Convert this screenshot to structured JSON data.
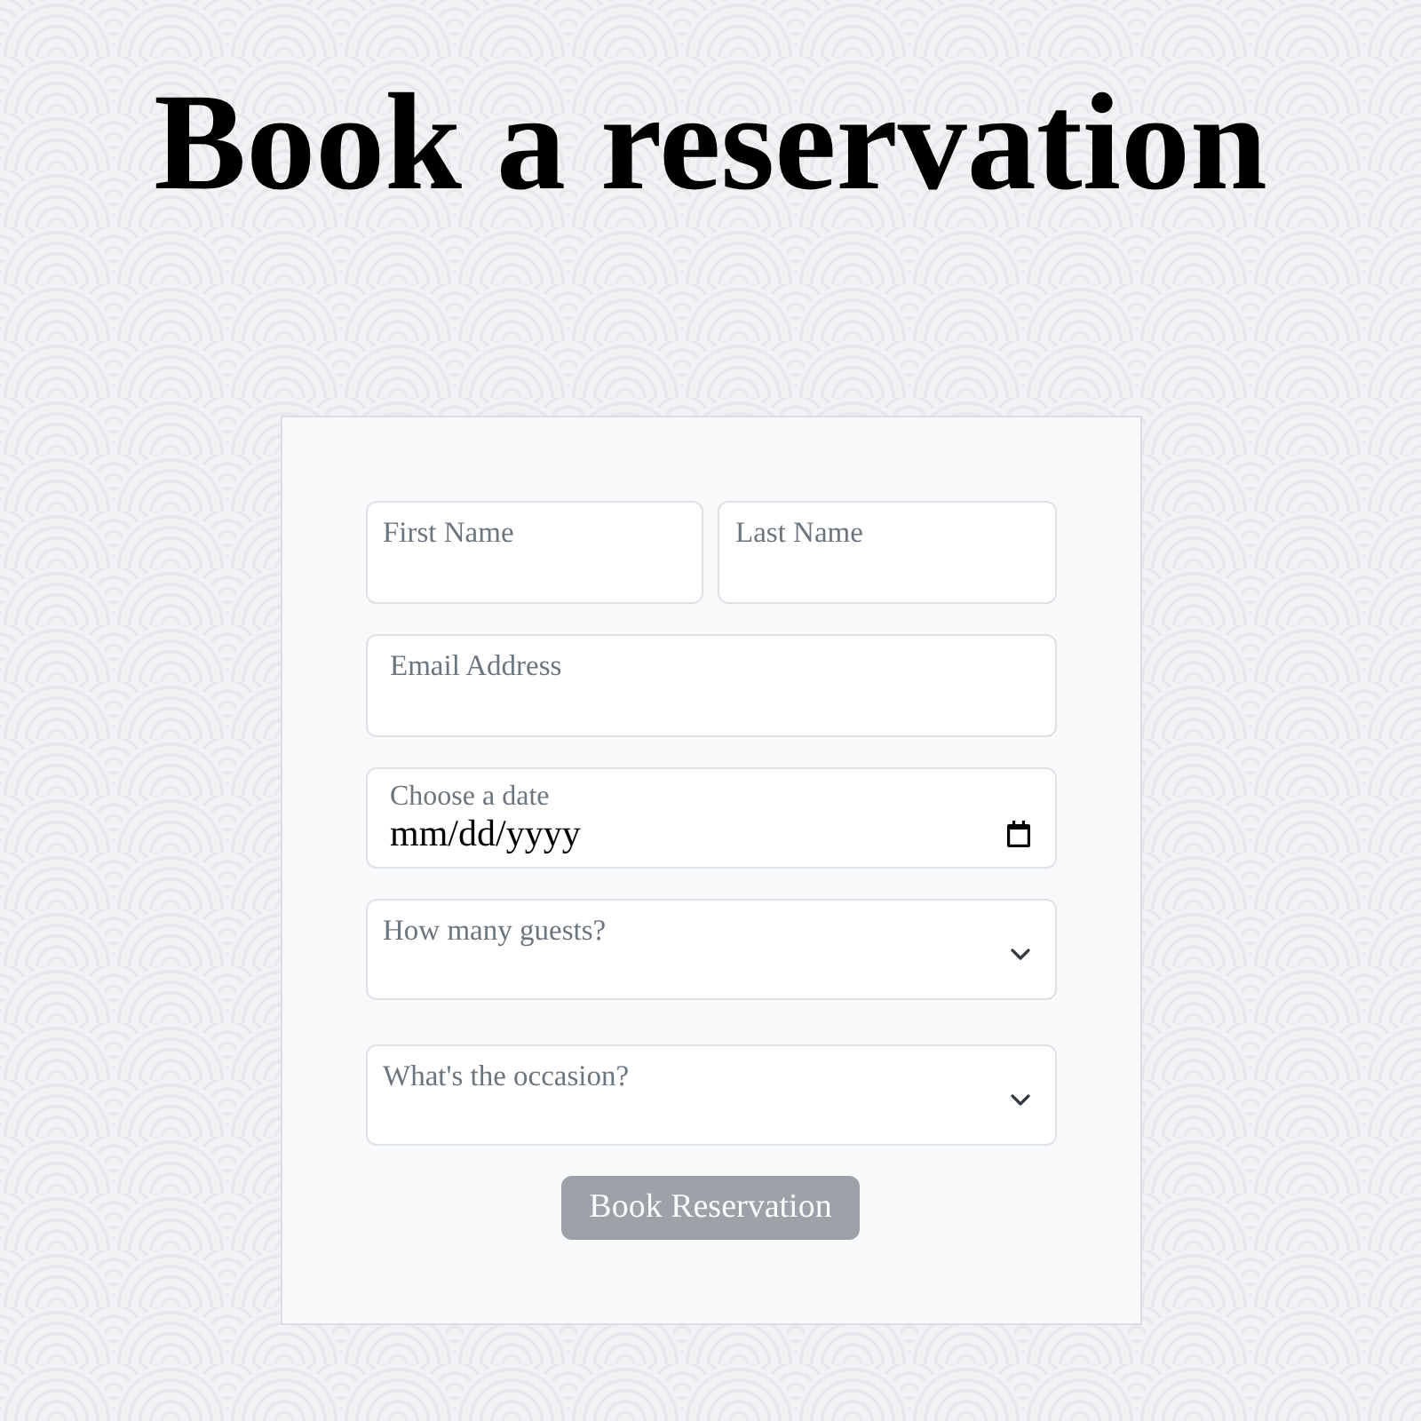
{
  "title": "Book a reservation",
  "form": {
    "name_fields": [
      {
        "placeholder": "First Name"
      },
      {
        "placeholder": "Last Name"
      }
    ],
    "fields": [
      {
        "kind": "email",
        "placeholder": "Email Address"
      },
      {
        "kind": "date",
        "label": "Choose a date",
        "placeholder": "mm/dd/yyyy"
      },
      {
        "kind": "select",
        "placeholder": "How many guests?"
      },
      {
        "kind": "select",
        "placeholder": "What's the occasion?"
      }
    ],
    "submit_button": {
      "label": "Book Reservation",
      "disabled": true
    }
  }
}
